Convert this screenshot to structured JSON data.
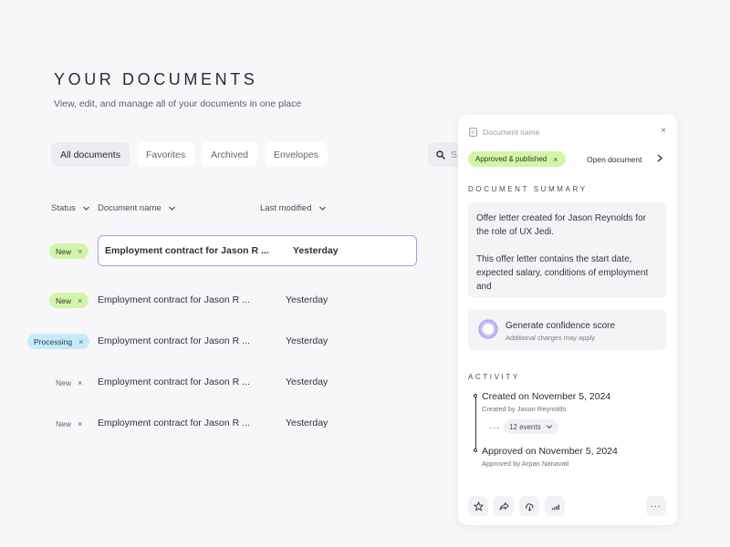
{
  "header": {
    "title": "YOUR DOCUMENTS",
    "subtitle": "View, edit, and manage all of your documents in one place"
  },
  "tabs": [
    {
      "label": "All documents",
      "active": true
    },
    {
      "label": "Favorites",
      "active": false
    },
    {
      "label": "Archived",
      "active": false
    },
    {
      "label": "Envelopes",
      "active": false
    }
  ],
  "search": {
    "placeholder": "S",
    "icon": "search-icon"
  },
  "columns": {
    "status": "Status",
    "name": "Document name",
    "modified": "Last modified"
  },
  "rows": [
    {
      "status": "New",
      "status_color": "#d3f5a8",
      "name": "Employment contract for Jason R ...",
      "modified": "Yesterday",
      "selected": true
    },
    {
      "status": "New",
      "status_color": "#d3f5a8",
      "name": "Employment contract for Jason R ...",
      "modified": "Yesterday",
      "selected": false
    },
    {
      "status": "Processing",
      "status_color": "#c5ebfb",
      "name": "Employment contract for Jason R ...",
      "modified": "Yesterday",
      "selected": false
    },
    {
      "status": "New",
      "status_color": "transparent",
      "name": "Employment contract for Jason R ...",
      "modified": "Yesterday",
      "selected": false
    },
    {
      "status": "New",
      "status_color": "transparent",
      "name": "Employment contract for Jason R ...",
      "modified": "Yesterday",
      "selected": false
    }
  ],
  "panel": {
    "doc_name_placeholder": "Document name",
    "close_symbol": "×",
    "status_pill": "Approved & published",
    "open_document": "Open document",
    "summary_label": "DOCUMENT SUMMARY",
    "summary_paragraphs": [
      "Offer letter created for Jason Reynolds for the role of UX Jedi.",
      "This offer letter contains the start date, expected salary, conditions of employment and"
    ],
    "confidence_title": "Generate confidence score",
    "confidence_sub": "Additional charges may apply",
    "activity_label": "ACTIVITY",
    "activity": [
      {
        "title": "Created on November 5, 2024",
        "sub": "Created by Jason Reynolds"
      },
      {
        "title": "Approved on November 5, 2024",
        "sub": "Approved by Arpan Nanavati"
      }
    ],
    "more_symbol": "···",
    "events_label": "12 events",
    "actions": [
      "star-icon",
      "share-icon",
      "cloud-download-icon",
      "signal-icon",
      "more-icon"
    ],
    "more_actions_symbol": "···"
  },
  "colors": {
    "accent_border": "#a99ee0",
    "green_badge": "#d3f5a8",
    "blue_badge": "#c5ebfb"
  }
}
